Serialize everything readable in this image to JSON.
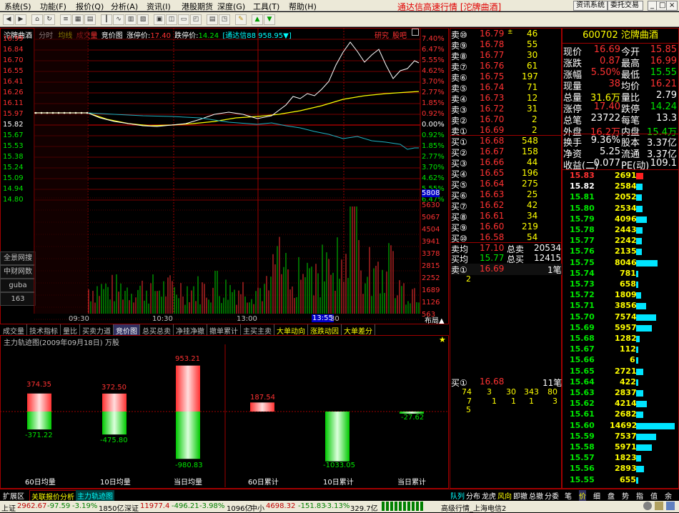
{
  "menu": {
    "items": [
      "系统(S)",
      "功能(F)",
      "报价(Q)",
      "分析(A)",
      "资讯(I)",
      "港股期货",
      "深度(G)",
      "工具(T)",
      "帮助(H)"
    ],
    "title": "通达信高速行情 [沱牌曲酒]",
    "btn_info": "资讯系统",
    "btn_trade": "委托交易"
  },
  "chart_header": {
    "name": "沱牌曲酒",
    "mode": "分时",
    "avg_label": "均线",
    "vol_label": "成交量",
    "auction_label": "竞价图",
    "limit_up_label": "涨停价:",
    "limit_up": "17.40",
    "limit_down_label": "跌停价:",
    "limit_down": "14.24",
    "broker": "[通达信88 958.95▼]",
    "research": "研究",
    "forum": "股吧"
  },
  "price_axis": {
    "left": [
      "16.99",
      "16.84",
      "16.70",
      "16.55",
      "16.41",
      "16.26",
      "16.11",
      "15.97",
      "15.82",
      "15.67",
      "15.53",
      "15.38",
      "15.24",
      "15.09",
      "14.94",
      "14.80"
    ],
    "right": [
      "7.40%",
      "6.47%",
      "5.55%",
      "4.62%",
      "3.70%",
      "2.77%",
      "1.85%",
      "0.92%",
      "0.00%",
      "0.92%",
      "1.85%",
      "2.77%",
      "3.70%",
      "4.62%",
      "5.55%",
      "6.47%"
    ]
  },
  "volume_axis": [
    "5808",
    "5630",
    "5067",
    "4504",
    "3941",
    "3378",
    "2815",
    "2252",
    "1689",
    "1126",
    "563"
  ],
  "time_axis": [
    "09:30",
    "10:30",
    "13:00",
    "13:55",
    "14:00"
  ],
  "layout_btn": "布局▲",
  "left_side": {
    "labels": [
      "全景网搜",
      "中财网数",
      "guba",
      "163"
    ]
  },
  "tabs": [
    "成交量",
    "技术指标",
    "量比",
    "买卖力道",
    "竞价图",
    "总买总卖",
    "净挂净撤",
    "撤单累计",
    "主买主卖",
    "大单动向",
    "涨跌动因",
    "大单差分"
  ],
  "mf": {
    "title": "主力轨迹图(2009年09月18日)  万股",
    "star": "★",
    "bars": [
      {
        "label": "60日均量",
        "up": 374.35,
        "down": -371.22
      },
      {
        "label": "10日均量",
        "up": 372.5,
        "down": -475.8
      },
      {
        "label": "当日均量",
        "up": 953.21,
        "down": -980.83
      },
      {
        "label": "60日累计",
        "up": 187.54,
        "down": null
      },
      {
        "label": "10日累计",
        "up": null,
        "down": -1033.05
      },
      {
        "label": "当日累计",
        "up": null,
        "down": -27.62
      }
    ],
    "up_labels": [
      "374.35",
      "372.50",
      "953.21",
      "187.54"
    ],
    "down_labels": [
      "-371.22",
      "-475.80",
      "-980.83",
      "-1033.05",
      "-27.62"
    ]
  },
  "asks": [
    {
      "l": "卖⑩",
      "p": "16.79",
      "v": "46",
      "mark": "±"
    },
    {
      "l": "卖⑨",
      "p": "16.78",
      "v": "55"
    },
    {
      "l": "卖⑧",
      "p": "16.77",
      "v": "30"
    },
    {
      "l": "卖⑦",
      "p": "16.76",
      "v": "61"
    },
    {
      "l": "卖⑥",
      "p": "16.75",
      "v": "197"
    },
    {
      "l": "卖⑤",
      "p": "16.74",
      "v": "71"
    },
    {
      "l": "卖④",
      "p": "16.73",
      "v": "12"
    },
    {
      "l": "卖③",
      "p": "16.72",
      "v": "31"
    },
    {
      "l": "卖②",
      "p": "16.70",
      "v": "2"
    },
    {
      "l": "卖①",
      "p": "16.69",
      "v": "2"
    }
  ],
  "bids": [
    {
      "l": "买①",
      "p": "16.68",
      "v": "548"
    },
    {
      "l": "买②",
      "p": "16.67",
      "v": "158"
    },
    {
      "l": "买③",
      "p": "16.66",
      "v": "44"
    },
    {
      "l": "买④",
      "p": "16.65",
      "v": "196"
    },
    {
      "l": "买⑤",
      "p": "16.64",
      "v": "275"
    },
    {
      "l": "买⑥",
      "p": "16.63",
      "v": "25"
    },
    {
      "l": "买⑦",
      "p": "16.62",
      "v": "42"
    },
    {
      "l": "买⑧",
      "p": "16.61",
      "v": "34"
    },
    {
      "l": "买⑨",
      "p": "16.60",
      "v": "219"
    },
    {
      "l": "买⑩",
      "p": "16.58",
      "v": "54"
    }
  ],
  "avg": {
    "ask_l": "卖均",
    "ask_p": "17.10",
    "ask_t": "总卖",
    "ask_v": "20534",
    "bid_l": "买均",
    "bid_p": "15.77",
    "bid_t": "总买",
    "bid_v": "12415"
  },
  "ask1_detail": {
    "l": "卖①",
    "p": "16.69",
    "n": "1笔",
    "q": "2"
  },
  "bid1_detail": {
    "l": "买①",
    "p": "16.68",
    "n": "11笔",
    "row1": [
      "74",
      "3",
      "30",
      "343",
      "80"
    ],
    "row2": [
      "7",
      "1",
      "1",
      "1",
      "3"
    ],
    "row3": [
      "5"
    ]
  },
  "stock": {
    "code": "600702",
    "name": "沱牌曲酒"
  },
  "stats": [
    {
      "a": "现价",
      "av": "16.69",
      "b": "今开",
      "bv": "15.85"
    },
    {
      "a": "涨跌",
      "av": "0.87",
      "b": "最高",
      "bv": "16.99"
    },
    {
      "a": "涨幅",
      "av": "5.50%",
      "b": "最低",
      "bv": "15.55"
    },
    {
      "a": "现量",
      "av": "38",
      "b": "均价",
      "bv": "16.21"
    },
    {
      "a": "总量",
      "av": "31.6万",
      "b": "量比",
      "bv": "2.79"
    },
    {
      "a": "涨停",
      "av": "17.40",
      "b": "跌停",
      "bv": "14.24"
    },
    {
      "a": "总笔",
      "av": "23722",
      "b": "每笔",
      "bv": "13.3"
    },
    {
      "a": "外盘",
      "av": "16.2万",
      "b": "内盘",
      "bv": "15.4万"
    }
  ],
  "stats2": [
    {
      "a": "换手",
      "av": "9.36%",
      "b": "股本",
      "bv": "3.37亿"
    },
    {
      "a": "净资",
      "av": "5.25",
      "b": "流通",
      "bv": "3.37亿"
    },
    {
      "a": "收益(二)",
      "av": "0.077",
      "b": "PE(动)",
      "bv": "109.1"
    }
  ],
  "ticks": [
    {
      "p": "15.83",
      "v": "2691"
    },
    {
      "p": "15.82",
      "v": "2584"
    },
    {
      "p": "15.81",
      "v": "2052"
    },
    {
      "p": "15.80",
      "v": "2534"
    },
    {
      "p": "15.79",
      "v": "4096"
    },
    {
      "p": "15.78",
      "v": "2443"
    },
    {
      "p": "15.77",
      "v": "2242"
    },
    {
      "p": "15.76",
      "v": "2135"
    },
    {
      "p": "15.75",
      "v": "8046"
    },
    {
      "p": "15.74",
      "v": "781"
    },
    {
      "p": "15.73",
      "v": "658"
    },
    {
      "p": "15.72",
      "v": "1809"
    },
    {
      "p": "15.71",
      "v": "3856"
    },
    {
      "p": "15.70",
      "v": "7574"
    },
    {
      "p": "15.69",
      "v": "5957"
    },
    {
      "p": "15.68",
      "v": "1282"
    },
    {
      "p": "15.67",
      "v": "112"
    },
    {
      "p": "15.66",
      "v": "6"
    },
    {
      "p": "15.65",
      "v": "2721"
    },
    {
      "p": "15.64",
      "v": "422"
    },
    {
      "p": "15.63",
      "v": "2837"
    },
    {
      "p": "15.62",
      "v": "4214"
    },
    {
      "p": "15.61",
      "v": "2682"
    },
    {
      "p": "15.60",
      "v": "14692"
    },
    {
      "p": "15.59",
      "v": "7537"
    },
    {
      "p": "15.58",
      "v": "5971"
    },
    {
      "p": "15.57",
      "v": "1823"
    },
    {
      "p": "15.56",
      "v": "2893"
    },
    {
      "p": "15.55",
      "v": "655"
    }
  ],
  "right_tabs": [
    "笔",
    "价",
    "细",
    "盘",
    "势",
    "指",
    "值",
    "余"
  ],
  "mid_tabs": [
    "队列",
    "分布",
    "龙虎",
    "风向",
    "即撤",
    "总撤",
    "分委"
  ],
  "bottom_tabs": [
    "扩展区",
    "关联报价分析",
    "主力轨迹图"
  ],
  "status": {
    "sh_label": "上证",
    "sh": "2962.67",
    "sh_chg": "-97.59",
    "sh_pct": "-3.19%",
    "sh_amt": "1850亿",
    "sz_label": "深证",
    "sz": "11977.4",
    "sz_chg": "-496.21",
    "sz_pct": "-3.98%",
    "sz_amt": "1096亿",
    "zx_label": "中小",
    "zx": "4698.32",
    "zx_chg": "-151.83",
    "zx_pct": "-3.13%",
    "zx_amt": "329.7亿",
    "server": "高级行情_上海电信2"
  }
}
